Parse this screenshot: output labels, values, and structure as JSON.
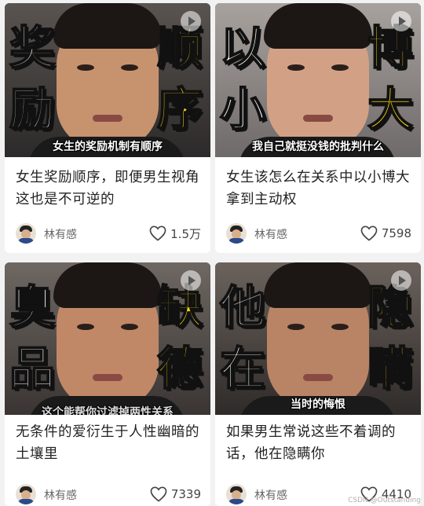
{
  "cards": [
    {
      "big_chars": [
        "奖",
        "励",
        "顺",
        "序"
      ],
      "subtitle": "女生的奖励机制有顺序",
      "title": "女生奖励顺序，即便男生视角这也是不可逆的",
      "author": "林有感",
      "likes": "1.5万"
    },
    {
      "big_chars": [
        "以",
        "小",
        "博",
        "大"
      ],
      "subtitle": "我自己就挺没钱的批判什么",
      "title": "女生该怎么在关系中以小博大拿到主动权",
      "author": "林有感",
      "likes": "7598"
    },
    {
      "big_chars": [
        "臭",
        "品",
        "缺",
        "德"
      ],
      "subtitle": "这个能帮你过滤掉两性关系",
      "title": "无条件的爱衍生于人性幽暗的土壤里",
      "author": "林有感",
      "likes": "7339"
    },
    {
      "big_chars": [
        "他",
        "在",
        "隐",
        "瞒"
      ],
      "subtitle": "当时的悔恨",
      "title": "如果男生常说这些不着调的话，他在隐瞒你",
      "author": "林有感",
      "likes": "4410"
    }
  ],
  "watermark": "CSDN @Outstanding",
  "colors": {
    "accent_yellow": "#f5d60a",
    "page_bg": "#f2f2f2",
    "card_bg": "#ffffff"
  },
  "icons": {
    "like": "heart-outline-icon",
    "play": "play-icon"
  }
}
